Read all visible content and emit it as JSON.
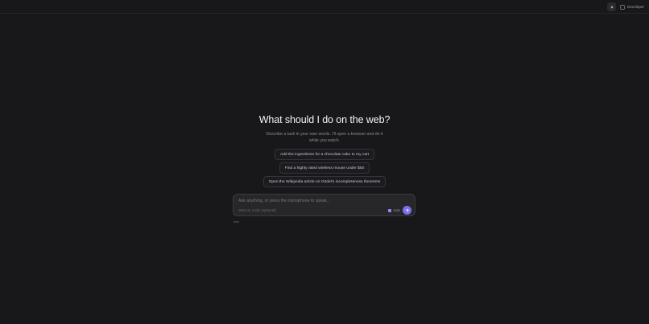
{
  "header": {
    "developer_label": "Developer"
  },
  "hero": {
    "title": "What should I do on the web?",
    "subtitle": "Describe a task in your own words. I'll open a browser and do it while you watch."
  },
  "suggestions": [
    "Add the ingredients for a chocolate cake to my cart",
    "Find a highly rated wireless mouse under $50",
    "Open the Wikipedia article on Gödel's incompleteness theorems"
  ],
  "composer": {
    "placeholder": "Ask anything, or press the microphone to speak...",
    "url_placeholder": "Start on a site (optional)",
    "auto_label": "Auto"
  },
  "footnote": "new",
  "colors": {
    "background": "#18181b",
    "accent": "#7c6ff0"
  }
}
